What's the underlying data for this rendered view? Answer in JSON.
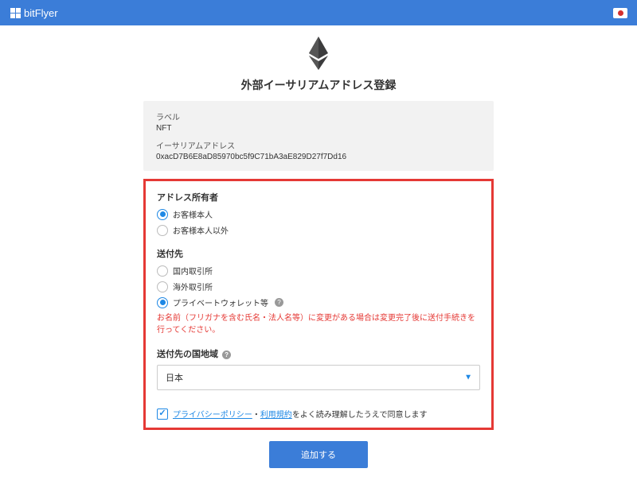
{
  "header": {
    "brand": "bitFlyer"
  },
  "page": {
    "title": "外部イーサリアムアドレス登録"
  },
  "summary": {
    "label_title": "ラベル",
    "label_value": "NFT",
    "addr_title": "イーサリアムアドレス",
    "addr_value": "0xacD7B6E8aD85970bc5f9C71bA3aE829D27f7Dd16"
  },
  "owner": {
    "title": "アドレス所有者",
    "options": [
      "お客様本人",
      "お客様本人以外"
    ],
    "selected": 0
  },
  "destination": {
    "title": "送付先",
    "options": [
      "国内取引所",
      "海外取引所",
      "プライベートウォレット等"
    ],
    "selected": 2,
    "warning": "お名前（フリガナを含む氏名・法人名等）に変更がある場合は変更完了後に送付手続きを行ってください。"
  },
  "country": {
    "title": "送付先の国地域",
    "value": "日本"
  },
  "consent": {
    "link1": "プライバシーポリシー",
    "sep": "・",
    "link2": "利用規約",
    "suffix": "をよく読み理解したうえで同意します",
    "checked": true
  },
  "submit": {
    "label": "追加する"
  }
}
